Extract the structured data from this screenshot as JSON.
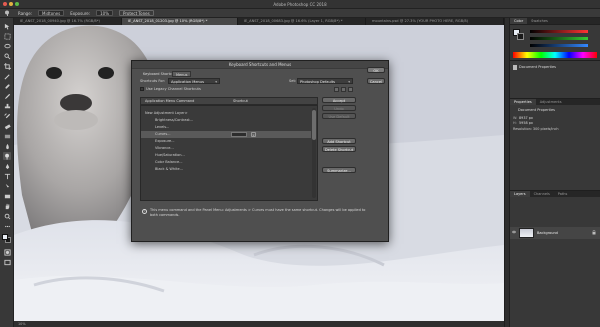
{
  "window": {
    "title": "Adobe Photoshop CC 2018"
  },
  "options_bar": {
    "range_label": "Range:",
    "range_value": "Midtones",
    "exposure_label": "Exposure:",
    "exposure_value": "10%",
    "protect_tones": "Protect Tones"
  },
  "doc_tabs": [
    {
      "label": "IE_ANST_2018_00940.jpg @ 16.7% (RGB/8*)"
    },
    {
      "label": "IE_ANST_2018_01203.jpg @ 10% (RGB/8*) *",
      "active": true
    },
    {
      "label": "IE_ANST_2018_00683.jpg @ 16.6% (Layer 1, RGB/8*) *"
    },
    {
      "label": "mountains.psd @ 27.3% (YOUR PHOTO HERE, RGB/8)"
    }
  ],
  "status": {
    "zoom": "10%"
  },
  "dialog": {
    "title": "Keyboard Shortcuts and Menus",
    "tabs": [
      "Keyboard Shortcuts",
      "Menus"
    ],
    "shortcuts_for_label": "Shortcuts For:",
    "shortcuts_for_value": "Application Menus",
    "set_label": "Set:",
    "set_value": "Photoshop Defaults",
    "legacy_checkbox": "Use Legacy Channel Shortcuts",
    "col_command": "Application Menu Command",
    "col_shortcut": "Shortcut",
    "rows": [
      {
        "text": "New Adjustment Layer>",
        "indent": 0
      },
      {
        "text": "Brightness/Contrast...",
        "indent": 1
      },
      {
        "text": "Levels...",
        "indent": 1
      },
      {
        "text": "Curves...",
        "indent": 1,
        "selected": true
      },
      {
        "text": "Exposure...",
        "indent": 1
      },
      {
        "text": "Vibrance...",
        "indent": 1
      },
      {
        "text": "Hue/Saturation...",
        "indent": 1
      },
      {
        "text": "Color Balance...",
        "indent": 1
      },
      {
        "text": "Black & White...",
        "indent": 1
      }
    ],
    "buttons": {
      "accept": "Accept",
      "undo": "Undo",
      "use_default": "Use Default",
      "add_shortcut": "Add Shortcut",
      "delete_shortcut": "Delete Shortcut",
      "summarize": "Summarize...",
      "ok": "OK",
      "cancel": "Cancel"
    },
    "info_text": "This menu command and the Panel Menu: Adjustments > Curves must have the same shortcut. Changes will be applied to both commands."
  },
  "panels": {
    "color_tabs": [
      "Color",
      "Swatches"
    ],
    "history_item": "Document Properties",
    "properties_tabs": [
      "Properties",
      "Adjustments"
    ],
    "doc_props_title": "Document Properties",
    "width_label": "W:",
    "width_value": "8937 px",
    "height_label": "H:",
    "height_value": "5958 px",
    "resolution": "Resolution: 300 pixels/inch",
    "layers_tabs": [
      "Layers",
      "Channels",
      "Paths"
    ],
    "layer_name": "Background"
  },
  "colors": {
    "foreground": "#e8edf4",
    "background": "#1a1a1a"
  }
}
